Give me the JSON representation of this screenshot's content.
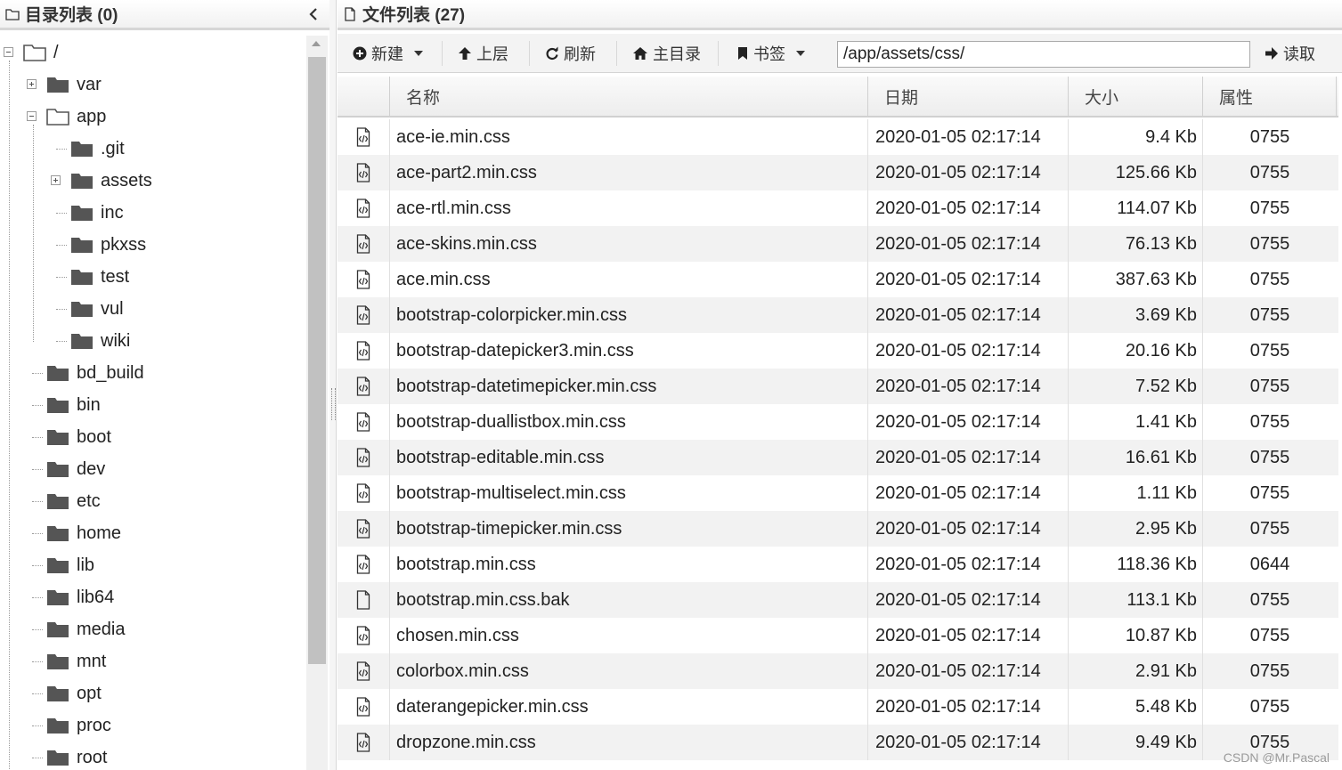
{
  "left_panel": {
    "title": "目录列表 (0)",
    "tree": [
      {
        "label": "/",
        "level": 0,
        "expanded": true
      },
      {
        "label": "var",
        "level": 1,
        "expandable": true
      },
      {
        "label": "app",
        "level": 1,
        "expanded": true
      },
      {
        "label": ".git",
        "level": 2
      },
      {
        "label": "assets",
        "level": 2,
        "expandable": true
      },
      {
        "label": "inc",
        "level": 2
      },
      {
        "label": "pkxss",
        "level": 2
      },
      {
        "label": "test",
        "level": 2
      },
      {
        "label": "vul",
        "level": 2
      },
      {
        "label": "wiki",
        "level": 2
      },
      {
        "label": "bd_build",
        "level": 1
      },
      {
        "label": "bin",
        "level": 1
      },
      {
        "label": "boot",
        "level": 1
      },
      {
        "label": "dev",
        "level": 1
      },
      {
        "label": "etc",
        "level": 1
      },
      {
        "label": "home",
        "level": 1
      },
      {
        "label": "lib",
        "level": 1
      },
      {
        "label": "lib64",
        "level": 1
      },
      {
        "label": "media",
        "level": 1
      },
      {
        "label": "mnt",
        "level": 1
      },
      {
        "label": "opt",
        "level": 1
      },
      {
        "label": "proc",
        "level": 1
      },
      {
        "label": "root",
        "level": 1
      }
    ]
  },
  "right_panel": {
    "title": "文件列表 (27)",
    "toolbar": {
      "new_label": "新建",
      "up_label": "上层",
      "refresh_label": "刷新",
      "home_label": "主目录",
      "bookmark_label": "书签",
      "path_value": "/app/assets/css/",
      "read_label": "读取"
    },
    "columns": {
      "name": "名称",
      "date": "日期",
      "size": "大小",
      "attr": "属性"
    },
    "files": [
      {
        "name": "ace-ie.min.css",
        "date": "2020-01-05 02:17:14",
        "size": "9.4 Kb",
        "attr": "0755",
        "icon": "code-file-icon"
      },
      {
        "name": "ace-part2.min.css",
        "date": "2020-01-05 02:17:14",
        "size": "125.66 Kb",
        "attr": "0755",
        "icon": "code-file-icon"
      },
      {
        "name": "ace-rtl.min.css",
        "date": "2020-01-05 02:17:14",
        "size": "114.07 Kb",
        "attr": "0755",
        "icon": "code-file-icon"
      },
      {
        "name": "ace-skins.min.css",
        "date": "2020-01-05 02:17:14",
        "size": "76.13 Kb",
        "attr": "0755",
        "icon": "code-file-icon"
      },
      {
        "name": "ace.min.css",
        "date": "2020-01-05 02:17:14",
        "size": "387.63 Kb",
        "attr": "0755",
        "icon": "code-file-icon"
      },
      {
        "name": "bootstrap-colorpicker.min.css",
        "date": "2020-01-05 02:17:14",
        "size": "3.69 Kb",
        "attr": "0755",
        "icon": "code-file-icon"
      },
      {
        "name": "bootstrap-datepicker3.min.css",
        "date": "2020-01-05 02:17:14",
        "size": "20.16 Kb",
        "attr": "0755",
        "icon": "code-file-icon"
      },
      {
        "name": "bootstrap-datetimepicker.min.css",
        "date": "2020-01-05 02:17:14",
        "size": "7.52 Kb",
        "attr": "0755",
        "icon": "code-file-icon"
      },
      {
        "name": "bootstrap-duallistbox.min.css",
        "date": "2020-01-05 02:17:14",
        "size": "1.41 Kb",
        "attr": "0755",
        "icon": "code-file-icon"
      },
      {
        "name": "bootstrap-editable.min.css",
        "date": "2020-01-05 02:17:14",
        "size": "16.61 Kb",
        "attr": "0755",
        "icon": "code-file-icon"
      },
      {
        "name": "bootstrap-multiselect.min.css",
        "date": "2020-01-05 02:17:14",
        "size": "1.11 Kb",
        "attr": "0755",
        "icon": "code-file-icon"
      },
      {
        "name": "bootstrap-timepicker.min.css",
        "date": "2020-01-05 02:17:14",
        "size": "2.95 Kb",
        "attr": "0755",
        "icon": "code-file-icon"
      },
      {
        "name": "bootstrap.min.css",
        "date": "2020-01-05 02:17:14",
        "size": "118.36 Kb",
        "attr": "0644",
        "icon": "code-file-icon"
      },
      {
        "name": "bootstrap.min.css.bak",
        "date": "2020-01-05 02:17:14",
        "size": "113.1 Kb",
        "attr": "0755",
        "icon": "blank-file-icon"
      },
      {
        "name": "chosen.min.css",
        "date": "2020-01-05 02:17:14",
        "size": "10.87 Kb",
        "attr": "0755",
        "icon": "code-file-icon"
      },
      {
        "name": "colorbox.min.css",
        "date": "2020-01-05 02:17:14",
        "size": "2.91 Kb",
        "attr": "0755",
        "icon": "code-file-icon"
      },
      {
        "name": "daterangepicker.min.css",
        "date": "2020-01-05 02:17:14",
        "size": "5.48 Kb",
        "attr": "0755",
        "icon": "code-file-icon"
      },
      {
        "name": "dropzone.min.css",
        "date": "2020-01-05 02:17:14",
        "size": "9.49 Kb",
        "attr": "0755",
        "icon": "code-file-icon"
      }
    ]
  },
  "watermark": "CSDN @Mr.Pascal",
  "colors": {
    "folder": "#555555",
    "row_alt": "#f2f2f2",
    "toolbar_bg": "#f3f3f3"
  }
}
